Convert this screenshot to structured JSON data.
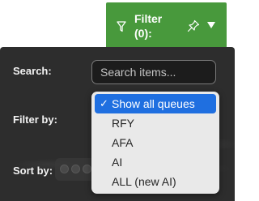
{
  "filter_tab": {
    "label": "Filter (0):",
    "color": "#48993c"
  },
  "panel": {
    "search_label": "Search:",
    "search_placeholder": "Search items...",
    "search_value": "",
    "filter_label": "Filter by:",
    "sort_label": "Sort by:"
  },
  "filter_menu": {
    "selected_index": 0,
    "check_glyph": "✓",
    "items": [
      {
        "label": "Show all queues"
      },
      {
        "label": "RFY"
      },
      {
        "label": "AFA"
      },
      {
        "label": "AI"
      },
      {
        "label": "ALL (new AI)"
      }
    ],
    "highlight_color": "#1f6fe0"
  }
}
